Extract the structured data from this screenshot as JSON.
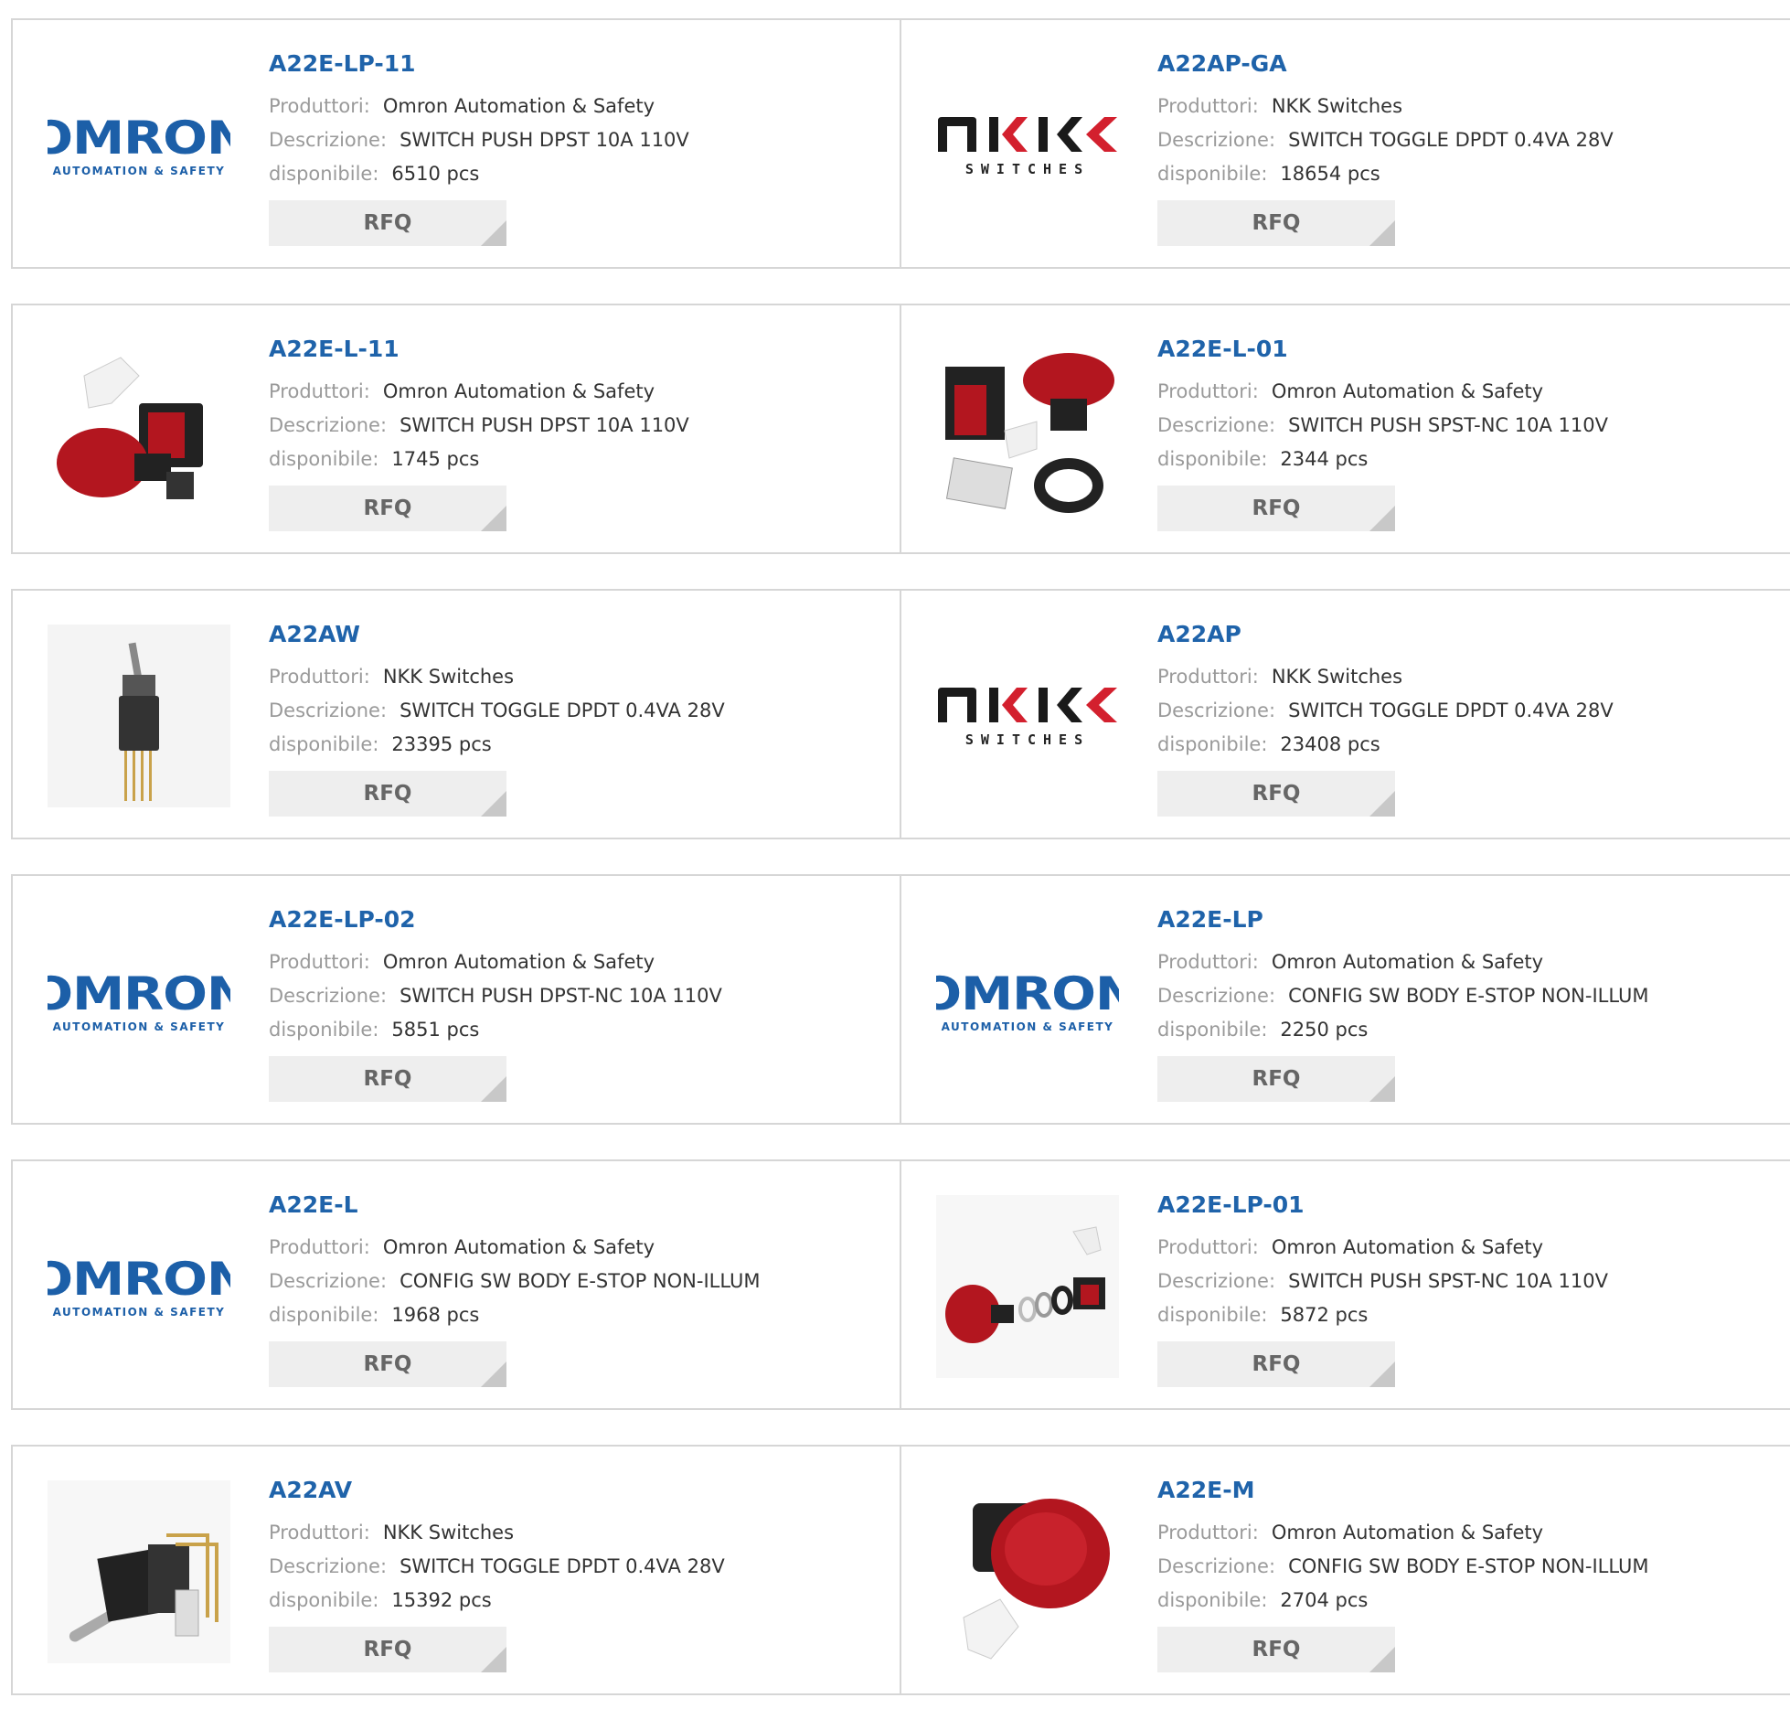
{
  "labels": {
    "manufacturer": "Produttori:",
    "description": "Descrizione:",
    "available": "disponibile:",
    "rfq": "RFQ"
  },
  "brand_logos": {
    "omron_word": "OMRON",
    "omron_sub": "AUTOMATION & SAFETY",
    "nkk_sub": "SWITCHES"
  },
  "colors": {
    "part_link": "#1f63aa",
    "label": "#9a9a9a",
    "value": "#333333",
    "rfq_bg": "#eeeeee",
    "border": "#d6d6d6"
  },
  "products": [
    {
      "part": "A22E-LP-11",
      "manufacturer": "Omron Automation & Safety",
      "description": "SWITCH PUSH DPST 10A 110V",
      "available": "6510 pcs",
      "image": "omron-logo"
    },
    {
      "part": "A22AP-GA",
      "manufacturer": "NKK Switches",
      "description": "SWITCH TOGGLE DPDT 0.4VA 28V",
      "available": "18654 pcs",
      "image": "nkk-logo"
    },
    {
      "part": "A22E-L-11",
      "manufacturer": "Omron Automation & Safety",
      "description": "SWITCH PUSH DPST 10A 110V",
      "available": "1745 pcs",
      "image": "estop-kit-photo"
    },
    {
      "part": "A22E-L-01",
      "manufacturer": "Omron Automation & Safety",
      "description": "SWITCH PUSH SPST-NC 10A 110V",
      "available": "2344 pcs",
      "image": "estop-parts-photo"
    },
    {
      "part": "A22AW",
      "manufacturer": "NKK Switches",
      "description": "SWITCH TOGGLE DPDT 0.4VA 28V",
      "available": "23395 pcs",
      "image": "toggle-switch-photo"
    },
    {
      "part": "A22AP",
      "manufacturer": "NKK Switches",
      "description": "SWITCH TOGGLE DPDT 0.4VA 28V",
      "available": "23408 pcs",
      "image": "nkk-logo"
    },
    {
      "part": "A22E-LP-02",
      "manufacturer": "Omron Automation & Safety",
      "description": "SWITCH PUSH DPST-NC 10A 110V",
      "available": "5851 pcs",
      "image": "omron-logo"
    },
    {
      "part": "A22E-LP",
      "manufacturer": "Omron Automation & Safety",
      "description": "CONFIG SW BODY E-STOP NON-ILLUM",
      "available": "2250 pcs",
      "image": "omron-logo"
    },
    {
      "part": "A22E-L",
      "manufacturer": "Omron Automation & Safety",
      "description": "CONFIG SW BODY E-STOP NON-ILLUM",
      "available": "1968 pcs",
      "image": "omron-logo"
    },
    {
      "part": "A22E-LP-01",
      "manufacturer": "Omron Automation & Safety",
      "description": "SWITCH PUSH SPST-NC 10A 110V",
      "available": "5872 pcs",
      "image": "estop-exploded-photo"
    },
    {
      "part": "A22AV",
      "manufacturer": "NKK Switches",
      "description": "SWITCH TOGGLE DPDT 0.4VA 28V",
      "available": "15392 pcs",
      "image": "right-angle-toggle-photo"
    },
    {
      "part": "A22E-M",
      "manufacturer": "Omron Automation & Safety",
      "description": "CONFIG SW BODY E-STOP NON-ILLUM",
      "available": "2704 pcs",
      "image": "estop-button-photo"
    }
  ]
}
